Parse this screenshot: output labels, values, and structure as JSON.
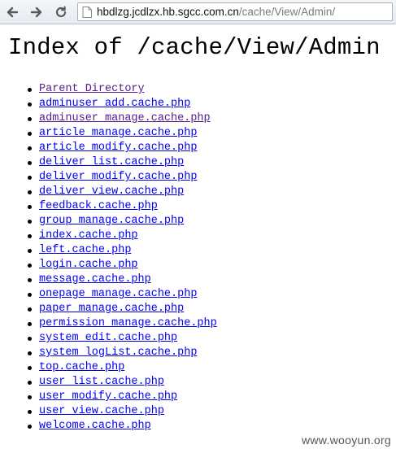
{
  "browser": {
    "url_host": "hbdlzg.jcdlzx.hb.sgcc.com.cn",
    "url_path": "/cache/View/Admin/"
  },
  "page": {
    "title": "Index of /cache/View/Admin"
  },
  "listing": [
    "Parent Directory",
    "adminuser_add.cache.php",
    "adminuser_manage.cache.php",
    "article_manage.cache.php",
    "article_modify.cache.php",
    "deliver_list.cache.php",
    "deliver_modify.cache.php",
    "deliver_view.cache.php",
    "feedback.cache.php",
    "group_manage.cache.php",
    "index.cache.php",
    "left.cache.php",
    "login.cache.php",
    "message.cache.php",
    "onepage_manage.cache.php",
    "paper_manage.cache.php",
    "permission_manage.cache.php",
    "system_edit.cache.php",
    "system_logList.cache.php",
    "top.cache.php",
    "user_list.cache.php",
    "user_modify.cache.php",
    "user_view.cache.php",
    "welcome.cache.php"
  ],
  "watermark": "www.wooyun.org",
  "colors": {
    "link": "#0000ee",
    "visited_link": "#551a8b"
  }
}
